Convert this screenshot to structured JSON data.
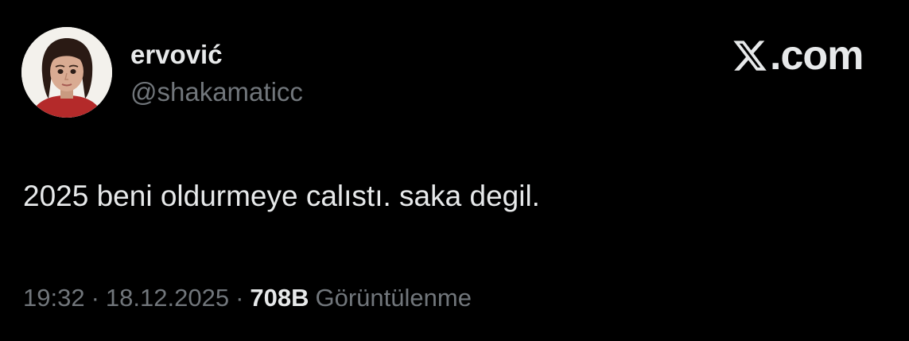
{
  "author": {
    "display_name": "ervović",
    "handle": "@shakamaticc"
  },
  "brand": {
    "text": ".com",
    "logo_icon": "x-logo-icon"
  },
  "tweet": {
    "text": "2025 beni oldurmeye calıstı. saka degil."
  },
  "meta": {
    "time": "19:32",
    "separator": "·",
    "date": "18.12.2025",
    "views_count": "708B",
    "views_label": "Görüntülenme"
  },
  "colors": {
    "background": "#000000",
    "primary_text": "#e7e9ea",
    "secondary_text": "#71767b"
  }
}
